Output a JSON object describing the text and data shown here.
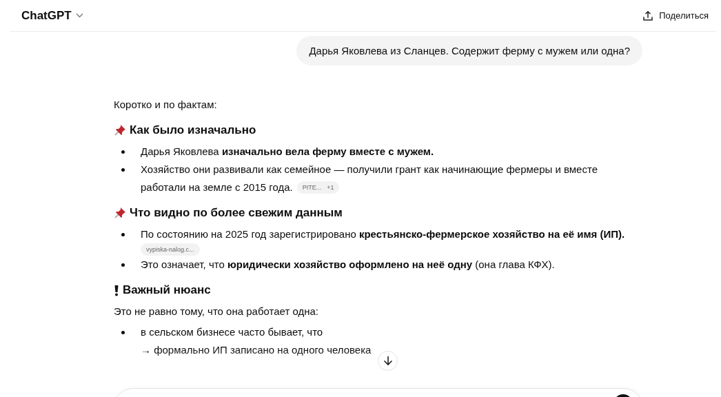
{
  "header": {
    "title": "ChatGPT",
    "share_label": "Поделиться"
  },
  "user_message": "Дарья Яковлева из Сланцев. Содержит ферму с мужем или одна?",
  "answer": [
    {
      "kind": "paragraph",
      "text": "Коротко и по фактам:"
    },
    {
      "kind": "pin_heading",
      "text": "Как было изначально"
    },
    {
      "kind": "bullets",
      "items": [
        {
          "lines": [
            "Дарья Яковлева **изначально вела ферму вместе с мужем.**"
          ]
        },
        {
          "lines": [
            "Хозяйство они развивали как семейное — получили грант как начинающие фермеры и вместе",
            "работали на земле с 2015 года."
          ],
          "source": {
            "label": "PITE...",
            "extra": "+1"
          }
        }
      ]
    },
    {
      "kind": "pin_heading",
      "text": "Что видно по более свежим данным"
    },
    {
      "kind": "bullets",
      "items": [
        {
          "lines": [
            "По состоянию на 2025 год зарегистрировано **крестьянско-фермерское хозяйство на её имя (ИП).**"
          ],
          "source": {
            "label": "vypiska-nalog.c..."
          }
        },
        {
          "lines": [
            "Это означает, что **юридически хозяйство оформлено на неё одну** (она глава КФХ)."
          ]
        }
      ]
    },
    {
      "kind": "alert_heading",
      "text": "Важный нюанс"
    },
    {
      "kind": "paragraph",
      "text": "Это не равно тому, что она работает одна:"
    },
    {
      "kind": "bullets",
      "items": [
        {
          "lines": [
            "в сельском бизнесе часто бывает, что",
            "→ формально ИП записано на одного человека"
          ]
        }
      ]
    }
  ]
}
